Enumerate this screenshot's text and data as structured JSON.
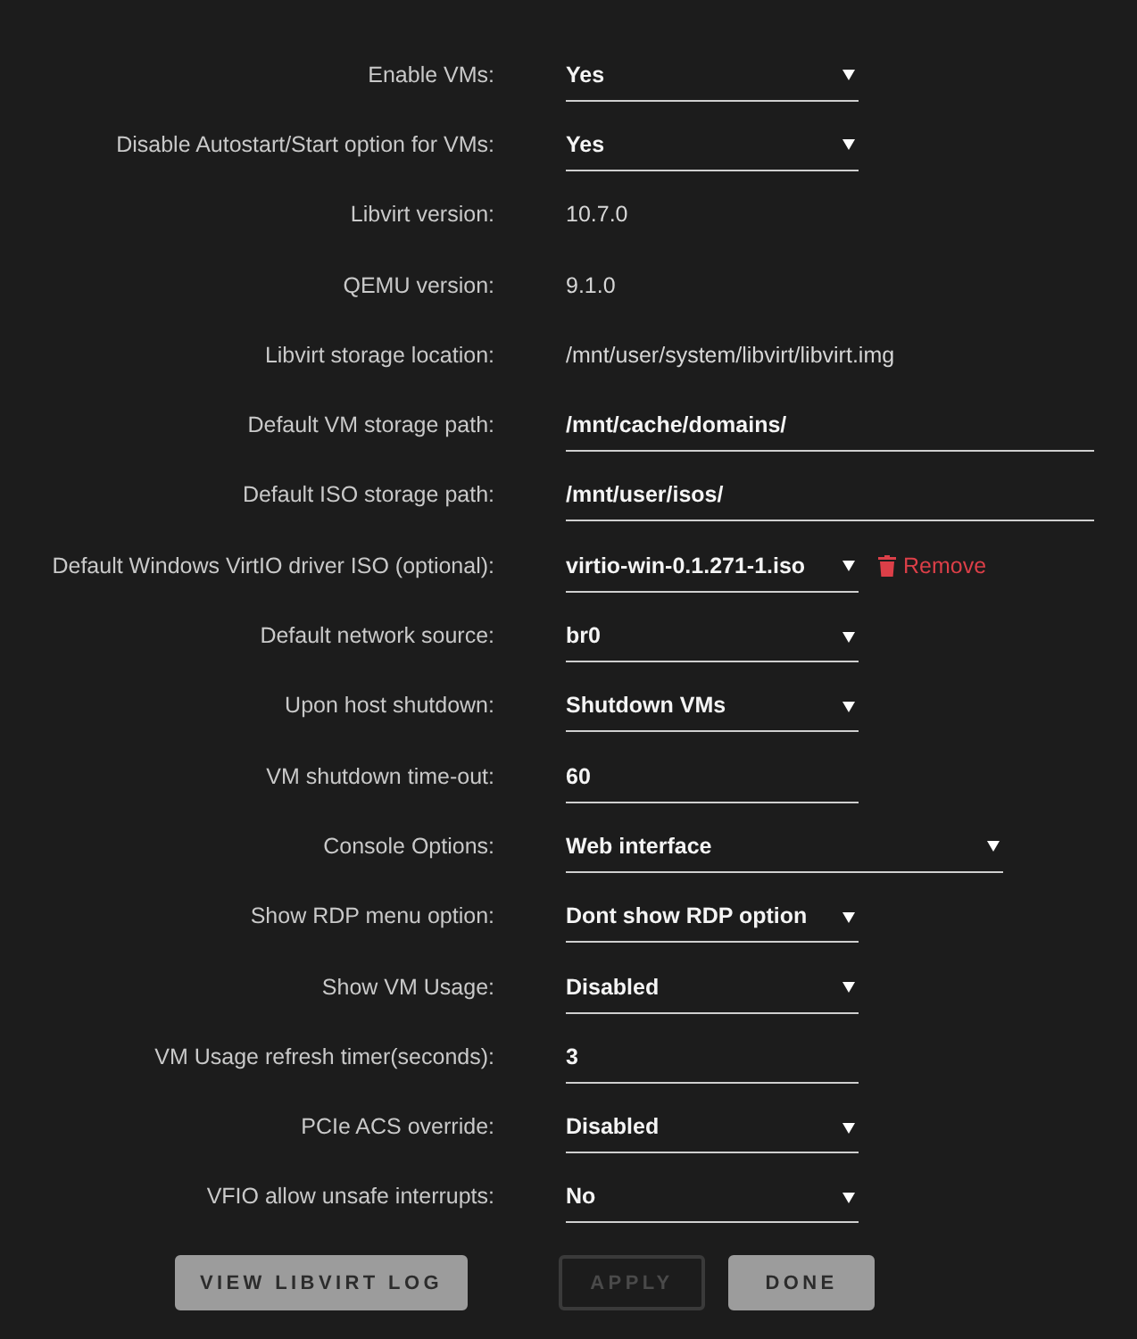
{
  "settings": [
    {
      "label": "Enable VMs:",
      "kind": "select",
      "value": "Yes"
    },
    {
      "label": "Disable Autostart/Start option for VMs:",
      "kind": "select",
      "value": "Yes"
    },
    {
      "label": "Libvirt version:",
      "kind": "info",
      "value": "10.7.0"
    },
    {
      "label": "QEMU version:",
      "kind": "info",
      "value": "9.1.0"
    },
    {
      "label": "Libvirt storage location:",
      "kind": "info",
      "value": "/mnt/user/system/libvirt/libvirt.img"
    },
    {
      "label": "Default VM storage path:",
      "kind": "path-input",
      "value": "/mnt/cache/domains/"
    },
    {
      "label": "Default ISO storage path:",
      "kind": "path-input",
      "value": "/mnt/user/isos/"
    },
    {
      "label": "Default Windows VirtIO driver ISO (optional):",
      "kind": "select",
      "value": "virtio-win-0.1.271-1.iso",
      "action": {
        "label": "Remove"
      }
    },
    {
      "label": "Default network source:",
      "kind": "select",
      "value": "br0"
    },
    {
      "label": "Upon host shutdown:",
      "kind": "select",
      "value": "Shutdown VMs"
    },
    {
      "label": "VM shutdown time-out:",
      "kind": "number-input",
      "value": "60"
    },
    {
      "label": "Console Options:",
      "kind": "wide-select",
      "value": "Web interface"
    },
    {
      "label": "Show RDP menu option:",
      "kind": "select",
      "value": "Dont show RDP option"
    },
    {
      "label": "Show VM Usage:",
      "kind": "select",
      "value": "Disabled"
    },
    {
      "label": "VM Usage refresh timer(seconds):",
      "kind": "number-input",
      "value": "3"
    },
    {
      "label": "PCIe ACS override:",
      "kind": "select",
      "value": "Disabled"
    },
    {
      "label": "VFIO allow unsafe interrupts:",
      "kind": "select",
      "value": "No"
    }
  ],
  "buttons": [
    {
      "label": "VIEW LIBVIRT LOG",
      "disabled": false
    },
    {
      "label": "APPLY",
      "disabled": true
    },
    {
      "label": "DONE",
      "disabled": false
    }
  ]
}
